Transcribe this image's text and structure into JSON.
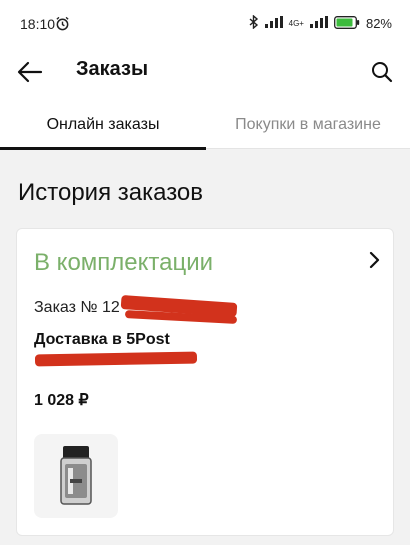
{
  "status_bar": {
    "time": "18:10",
    "network": "4G+",
    "battery": "82%"
  },
  "header": {
    "title": "Заказы"
  },
  "tabs": [
    {
      "label": "Онлайн заказы",
      "active": true
    },
    {
      "label": "Покупки в магазине",
      "active": false
    }
  ],
  "section": {
    "title": "История заказов"
  },
  "order": {
    "status": "В комплектации",
    "status_color": "#7bb06a",
    "number_prefix": "Заказ № 12",
    "delivery": "Доставка в 5Post",
    "price": "1 028 ₽",
    "redaction_color": "#d2321c"
  }
}
